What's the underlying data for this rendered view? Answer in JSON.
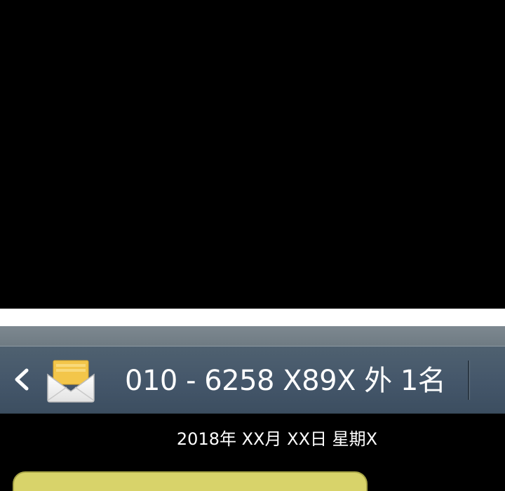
{
  "header": {
    "title": "010 - 6258 X89X 外 1名",
    "back_icon": "chevron-left-icon",
    "message_icon": "envelope-icon"
  },
  "conversation": {
    "date_separator": "2018年 XX月 XX日 星期X"
  },
  "colors": {
    "header": "#46586a",
    "bubble": "#d8d36a",
    "background": "#000000"
  }
}
